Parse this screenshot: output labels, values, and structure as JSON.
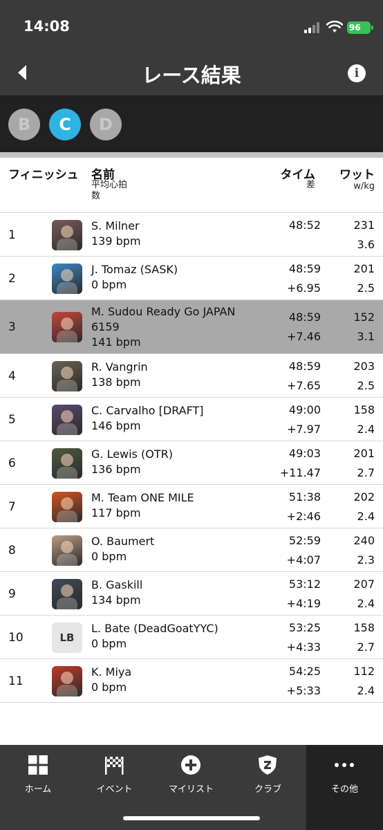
{
  "status": {
    "time": "14:08",
    "battery": "96"
  },
  "header": {
    "title": "レース結果"
  },
  "categories": [
    {
      "label": "B",
      "active": false
    },
    {
      "label": "C",
      "active": true
    },
    {
      "label": "D",
      "active": false
    }
  ],
  "columns": {
    "finish": "フィニッシュ",
    "name": "名前",
    "name_sub": "平均心拍\n数",
    "time": "タイム",
    "time_sub": "差",
    "watt": "ワット",
    "watt_sub": "w/kg"
  },
  "results": [
    {
      "pos": "1",
      "name": "S. Milner",
      "hr": "139 bpm",
      "time": "48:52",
      "gap": "",
      "watts": "231",
      "wkg": "3.6",
      "avatar": "sunset-photo",
      "avatar_color": "#7b5a5a"
    },
    {
      "pos": "2",
      "name": "J. Tomaz (SASK)",
      "hr": "0 bpm",
      "time": "48:59",
      "gap": "+6.95",
      "watts": "201",
      "wkg": "2.5",
      "avatar": "cyclist-photo",
      "avatar_color": "#3b86c6"
    },
    {
      "pos": "3",
      "name": "M. Sudou Ready Go JAPAN 6159",
      "hr": "141 bpm",
      "time": "48:59",
      "gap": "+7.46",
      "watts": "152",
      "wkg": "3.1",
      "avatar": "rider-red-jersey-photo",
      "avatar_color": "#c8443c",
      "highlight": true
    },
    {
      "pos": "4",
      "name": "R. Vangrin",
      "hr": "138 bpm",
      "time": "48:59",
      "gap": "+7.65",
      "watts": "203",
      "wkg": "2.5",
      "avatar": "rider-photo",
      "avatar_color": "#6b6152"
    },
    {
      "pos": "5",
      "name": "C. Carvalho [DRAFT]",
      "hr": "146 bpm",
      "time": "49:00",
      "gap": "+7.97",
      "watts": "158",
      "wkg": "2.4",
      "avatar": "portrait-photo",
      "avatar_color": "#5a4a6e"
    },
    {
      "pos": "6",
      "name": "G. Lewis (OTR)",
      "hr": "136 bpm",
      "time": "49:03",
      "gap": "+11.47",
      "watts": "201",
      "wkg": "2.7",
      "avatar": "portrait-photo",
      "avatar_color": "#4e5a3f"
    },
    {
      "pos": "7",
      "name": "M. Team ONE MILE",
      "hr": "117 bpm",
      "time": "51:38",
      "gap": "+2:46",
      "watts": "202",
      "wkg": "2.4",
      "avatar": "sunset-cyclist-photo",
      "avatar_color": "#d2551e"
    },
    {
      "pos": "8",
      "name": "O. Baumert",
      "hr": "0 bpm",
      "time": "52:59",
      "gap": "+4:07",
      "watts": "240",
      "wkg": "2.3",
      "avatar": "portrait-photo",
      "avatar_color": "#b99c86"
    },
    {
      "pos": "9",
      "name": "B. Gaskill",
      "hr": "134 bpm",
      "time": "53:12",
      "gap": "+4:19",
      "watts": "207",
      "wkg": "2.4",
      "avatar": "cyclists-photo",
      "avatar_color": "#3f4a55"
    },
    {
      "pos": "10",
      "name": "L. Bate (DeadGoatYYC)",
      "hr": "0 bpm",
      "time": "53:25",
      "gap": "+4:33",
      "watts": "158",
      "wkg": "2.7",
      "avatar": "initials",
      "initials": "LB",
      "avatar_color": "#e6e6e6"
    },
    {
      "pos": "11",
      "name": "K. Miya",
      "hr": "0 bpm",
      "time": "54:25",
      "gap": "+5:33",
      "watts": "112",
      "wkg": "2.4",
      "avatar": "character-photo",
      "avatar_color": "#c0392b"
    }
  ],
  "nav": [
    {
      "label": "ホーム",
      "icon": "grid-icon"
    },
    {
      "label": "イベント",
      "icon": "checkered-flag-icon"
    },
    {
      "label": "マイリスト",
      "icon": "plus-circle-icon"
    },
    {
      "label": "クラブ",
      "icon": "club-shield-icon"
    },
    {
      "label": "その他",
      "icon": "more-dots-icon",
      "active": true
    }
  ]
}
